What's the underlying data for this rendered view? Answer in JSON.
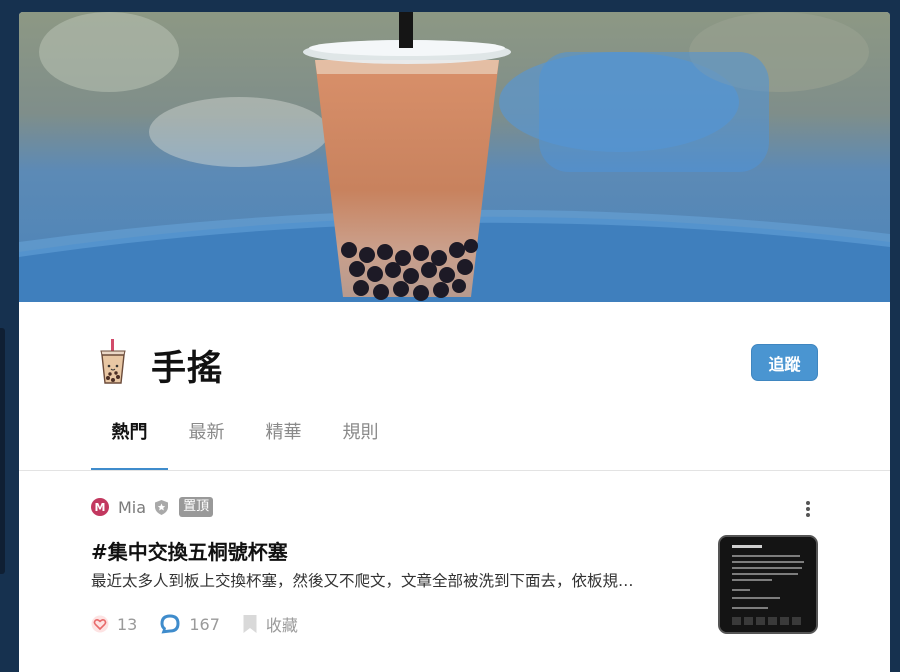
{
  "board": {
    "title": "手搖",
    "follow_label": "追蹤"
  },
  "tabs": [
    {
      "label": "熱門",
      "active": true
    },
    {
      "label": "最新",
      "active": false
    },
    {
      "label": "精華",
      "active": false
    },
    {
      "label": "規則",
      "active": false
    }
  ],
  "post": {
    "avatar_letter": "M",
    "author": "Mia",
    "pin_label": "置頂",
    "title": "#集中交換五桐號杯塞",
    "excerpt": "最近太多人到板上交換杯塞，然後又不爬文，文章全部被洗到下面去，依板規…",
    "like_count": "13",
    "comment_count": "167",
    "save_label": "收藏"
  },
  "colors": {
    "accent": "#4a95d1",
    "page_background": "#16314f",
    "avatar": "#c2385f",
    "like_heart": "#e86a6a",
    "comment_bubble": "#3f8ccc"
  },
  "icons": {
    "board": "bubble-tea-icon",
    "verified": "shield-icon",
    "more": "vertical-dots-icon",
    "like": "heart-icon",
    "comment": "comment-bubble-icon",
    "save": "bookmark-icon"
  }
}
